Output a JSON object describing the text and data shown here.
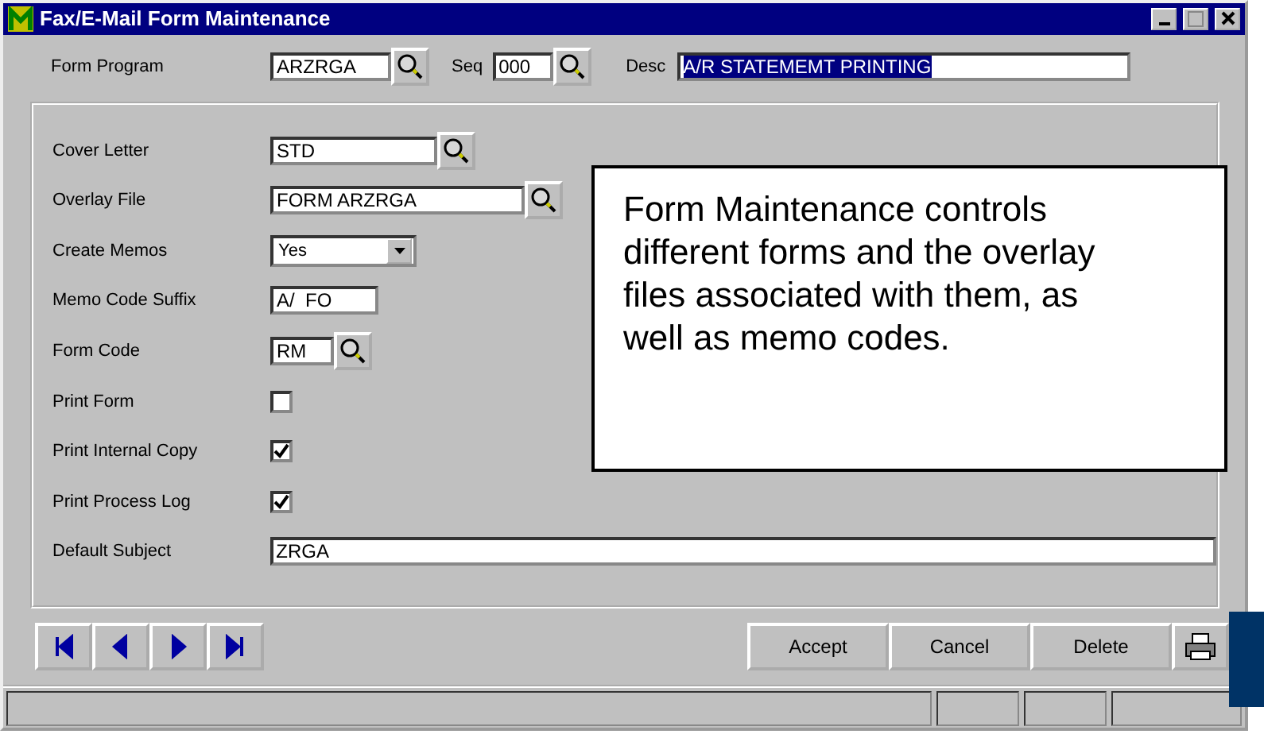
{
  "window": {
    "title": "Fax/E-Mail Form Maintenance"
  },
  "header": {
    "form_program": {
      "label": "Form Program",
      "value": "ARZRGA"
    },
    "seq": {
      "label": "Seq",
      "value": "000"
    },
    "desc": {
      "label": "Desc",
      "value": "A/R STATEMEMT PRINTING",
      "selected": true
    }
  },
  "fields": [
    {
      "label": "Cover Letter",
      "kind": "lookup",
      "value": "STD"
    },
    {
      "label": "Overlay File",
      "kind": "lookup",
      "value": "FORM ARZRGA"
    },
    {
      "label": "Create Memos",
      "kind": "dropdown",
      "value": "Yes"
    },
    {
      "label": "Memo Code Suffix",
      "kind": "text",
      "value": "A/  FO"
    },
    {
      "label": "Form Code",
      "kind": "lookup",
      "value": "RM"
    },
    {
      "label": "Print Form",
      "kind": "checkbox",
      "checked": false
    },
    {
      "label": "Print Internal Copy",
      "kind": "checkbox",
      "checked": true
    },
    {
      "label": "Print Process Log",
      "kind": "checkbox",
      "checked": true
    },
    {
      "label": "Default Subject",
      "kind": "text",
      "value": "ZRGA"
    }
  ],
  "callout": {
    "text": "Form Maintenance controls different forms and the overlay files associated with them, as well as memo codes."
  },
  "buttons": [
    "Accept",
    "Cancel",
    "Delete"
  ]
}
